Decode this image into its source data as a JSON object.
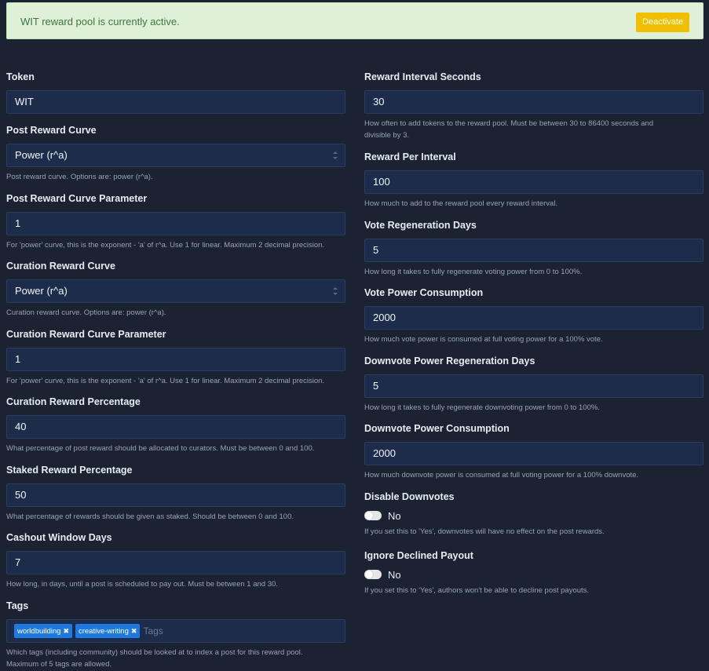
{
  "alert": {
    "text": "WIT reward pool is currently active.",
    "button": "Deactivate"
  },
  "left": {
    "token": {
      "label": "Token",
      "value": "WIT"
    },
    "post_curve": {
      "label": "Post Reward Curve",
      "value": "Power (r^a)",
      "help": "Post reward curve. Options are: power (r^a)."
    },
    "post_curve_param": {
      "label": "Post Reward Curve Parameter",
      "value": "1",
      "help": "For 'power' curve, this is the exponent - 'a' of r^a. Use 1 for linear. Maximum 2 decimal precision."
    },
    "curation_curve": {
      "label": "Curation Reward Curve",
      "value": "Power (r^a)",
      "help": "Curation reward curve. Options are: power (r^a)."
    },
    "curation_curve_param": {
      "label": "Curation Reward Curve Parameter",
      "value": "1",
      "help": "For 'power' curve, this is the exponent - 'a' of r^a. Use 1 for linear. Maximum 2 decimal precision."
    },
    "curation_pct": {
      "label": "Curation Reward Percentage",
      "value": "40",
      "help": "What percentage of post reward should be allocated to curators. Must be between 0 and 100."
    },
    "staked_pct": {
      "label": "Staked Reward Percentage",
      "value": "50",
      "help": "What percentage of rewards should be given as staked. Should be between 0 and 100."
    },
    "cashout": {
      "label": "Cashout Window Days",
      "value": "7",
      "help": "How long, in days, until a post is scheduled to pay out. Must be between 1 and 30."
    },
    "tags": {
      "label": "Tags",
      "items": [
        "worldbuilding",
        "creative-writing"
      ],
      "placeholder": "Tags",
      "help1": "Which tags (including community) should be looked at to index a post for this reward pool.",
      "help2": "Maximum of 5 tags are allowed."
    }
  },
  "right": {
    "interval": {
      "label": "Reward Interval Seconds",
      "value": "30",
      "help1": "How often to add tokens to the reward pool. Must be between 30 to 86400 seconds and",
      "help2": "divisible by 3."
    },
    "per_interval": {
      "label": "Reward Per Interval",
      "value": "100",
      "help": "How much to add to the reward pool every reward interval."
    },
    "vote_regen": {
      "label": "Vote Regeneration Days",
      "value": "5",
      "help": "How long it takes to fully regenerate voting power from 0 to 100%."
    },
    "vote_consumption": {
      "label": "Vote Power Consumption",
      "value": "2000",
      "help": "How much vote power is consumed at full voting power for a 100% vote."
    },
    "downvote_regen": {
      "label": "Downvote Power Regeneration Days",
      "value": "5",
      "help": "How long it takes to fully regenerate downvoting power from 0 to 100%."
    },
    "downvote_consumption": {
      "label": "Downvote Power Consumption",
      "value": "2000",
      "help": "How much downvote power is consumed at full voting power for a 100% downvote."
    },
    "disable_downvotes": {
      "label": "Disable Downvotes",
      "state": "No",
      "help": "If you set this to 'Yes', downvotes will have no effect on the post rewards."
    },
    "ignore_declined": {
      "label": "Ignore Declined Payout",
      "state": "No",
      "help": "If you set this to 'Yes', authors won't be able to decline post payouts."
    }
  }
}
